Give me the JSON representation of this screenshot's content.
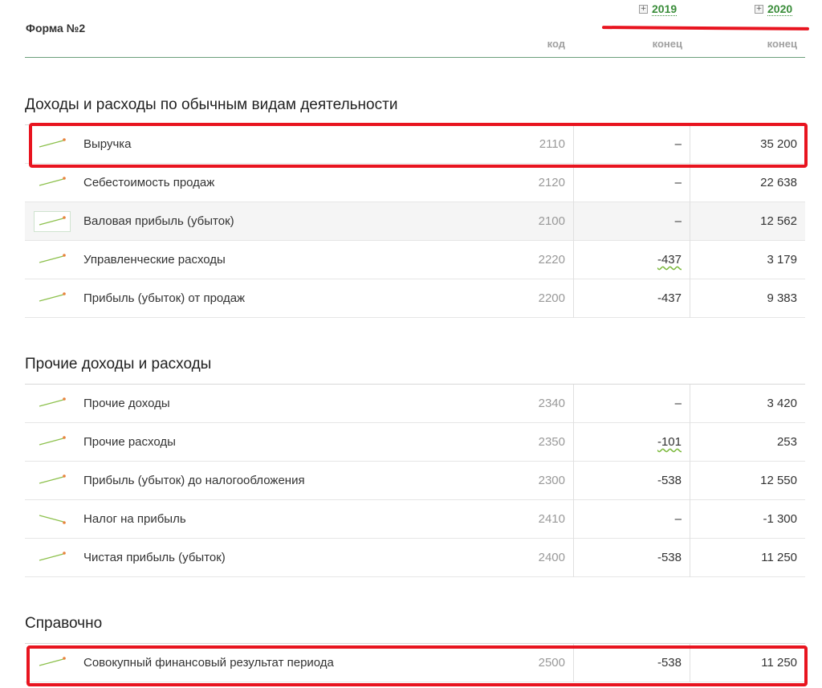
{
  "header": {
    "form_title": "Форма №2",
    "years": [
      "2019",
      "2020"
    ],
    "col_code": "код",
    "col_end_2019": "конец",
    "col_end_2020": "конец",
    "expand_glyph": "+"
  },
  "colors": {
    "accent_green": "#3a8d3a",
    "highlight_red": "#e8141f",
    "spark_line": "#8cc04b",
    "spark_dot": "#e8823c"
  },
  "sections": [
    {
      "title": "Доходы и расходы по обычным видам деятельности",
      "rows": [
        {
          "label": "Выручка",
          "code": "2110",
          "v2019": "–",
          "v2020": "35 200",
          "trend": "up"
        },
        {
          "label": "Себестоимость продаж",
          "code": "2120",
          "v2019": "–",
          "v2020": "22 638",
          "trend": "up"
        },
        {
          "label": "Валовая прибыль (убыток)",
          "code": "2100",
          "v2019": "–",
          "v2020": "12 562",
          "trend": "up"
        },
        {
          "label": "Управленческие расходы",
          "code": "2220",
          "v2019": "-437",
          "v2020": "3 179",
          "trend": "up"
        },
        {
          "label": "Прибыль (убыток) от продаж",
          "code": "2200",
          "v2019": "-437",
          "v2020": "9 383",
          "trend": "up"
        }
      ]
    },
    {
      "title": "Прочие доходы и расходы",
      "rows": [
        {
          "label": "Прочие доходы",
          "code": "2340",
          "v2019": "–",
          "v2020": "3 420",
          "trend": "up"
        },
        {
          "label": "Прочие расходы",
          "code": "2350",
          "v2019": "-101",
          "v2020": "253",
          "trend": "up"
        },
        {
          "label": "Прибыль (убыток) до налогообложения",
          "code": "2300",
          "v2019": "-538",
          "v2020": "12 550",
          "trend": "up"
        },
        {
          "label": "Налог на прибыль",
          "code": "2410",
          "v2019": "–",
          "v2020": "-1 300",
          "trend": "down"
        },
        {
          "label": "Чистая прибыль (убыток)",
          "code": "2400",
          "v2019": "-538",
          "v2020": "11 250",
          "trend": "up"
        }
      ]
    },
    {
      "title": "Справочно",
      "rows": [
        {
          "label": "Совокупный финансовый результат периода",
          "code": "2500",
          "v2019": "-538",
          "v2020": "11 250",
          "trend": "up"
        }
      ]
    }
  ]
}
